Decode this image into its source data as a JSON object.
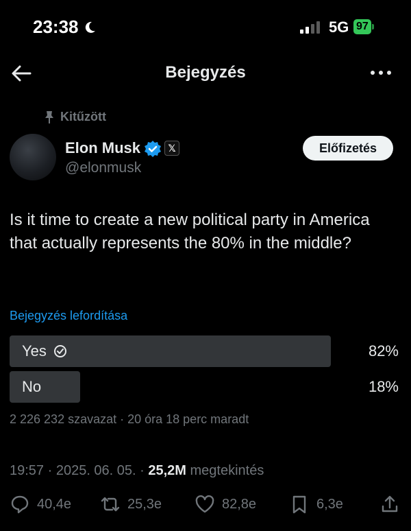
{
  "status_bar": {
    "time": "23:38",
    "network": "5G",
    "battery": "97"
  },
  "header": {
    "title": "Bejegyzés"
  },
  "post": {
    "pinned_label": "Kitűzött",
    "author_name": "Elon Musk",
    "handle": "@elonmusk",
    "subscribe_label": "Előfizetés",
    "text": "Is it time to create a new political party in America that actually represents the 80% in the middle?",
    "translate_label": "Bejegyzés lefordítása",
    "poll": {
      "options": [
        {
          "label": "Yes",
          "percent_label": "82%",
          "percent": 82,
          "selected": true
        },
        {
          "label": "No",
          "percent_label": "18%",
          "percent": 18,
          "selected": false
        }
      ],
      "meta": "2 226 232 szavazat · 20 óra 18 perc maradt"
    },
    "timestamp": {
      "date": "19:57 · 2025. 06. 05. · ",
      "views_count": "25,2M",
      "views_label": " megtekintés"
    },
    "actions": {
      "replies": "40,4e",
      "reposts": "25,3e",
      "likes": "82,8e",
      "bookmarks": "6,3e"
    }
  },
  "colors": {
    "background": "#000000",
    "link": "#1d9bf0",
    "verified": "#1d9bf0",
    "battery": "#34c759",
    "poll_bar": "#333639"
  }
}
